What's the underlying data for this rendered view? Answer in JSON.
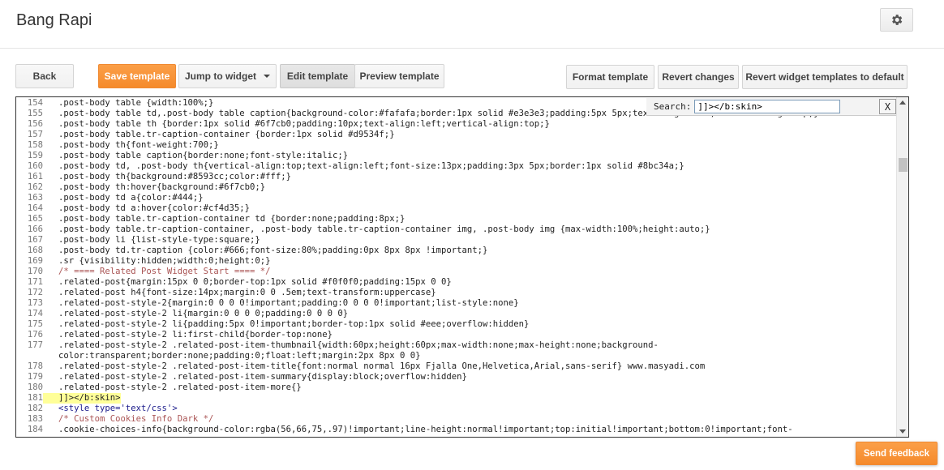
{
  "header": {
    "title": "Bang Rapi",
    "settings_icon": "gear-icon"
  },
  "toolbar": {
    "back": "Back",
    "save": "Save template",
    "jump": "Jump to widget",
    "edit": "Edit template",
    "preview": "Preview template",
    "format": "Format template",
    "revert": "Revert changes",
    "revert_widgets": "Revert widget templates to default"
  },
  "search": {
    "label": "Search:",
    "value": "]]></b:skin>",
    "close": "X"
  },
  "feedback": "Send feedback",
  "colors": {
    "accent": "#f58a2b",
    "highlight": "#ffff99"
  },
  "editor": {
    "lines": [
      {
        "n": "154",
        "text": ".post-body table {width:100%;}"
      },
      {
        "n": "155",
        "text": ".post-body table td,.post-body table caption{background-color:#fafafa;border:1px solid #e3e3e3;padding:5px 5px;text-align:left;vertical-align:top;}"
      },
      {
        "n": "156",
        "text": ".post-body table th {border:1px solid #6f7cb0;padding:10px;text-align:left;vertical-align:top;}"
      },
      {
        "n": "157",
        "text": ".post-body table.tr-caption-container {border:1px solid #d9534f;}"
      },
      {
        "n": "158",
        "text": ".post-body th{font-weight:700;}"
      },
      {
        "n": "159",
        "text": ".post-body table caption{border:none;font-style:italic;}"
      },
      {
        "n": "160",
        "text": ".post-body td, .post-body th{vertical-align:top;text-align:left;font-size:13px;padding:3px 5px;border:1px solid #8bc34a;}"
      },
      {
        "n": "161",
        "text": ".post-body th{background:#8593cc;color:#fff;}"
      },
      {
        "n": "162",
        "text": ".post-body th:hover{background:#6f7cb0;}"
      },
      {
        "n": "163",
        "text": ".post-body td a{color:#444;}"
      },
      {
        "n": "164",
        "text": ".post-body td a:hover{color:#cf4d35;}"
      },
      {
        "n": "165",
        "text": ".post-body table.tr-caption-container td {border:none;padding:8px;}"
      },
      {
        "n": "166",
        "text": ".post-body table.tr-caption-container, .post-body table.tr-caption-container img, .post-body img {max-width:100%;height:auto;}"
      },
      {
        "n": "167",
        "text": ".post-body li {list-style-type:square;}"
      },
      {
        "n": "168",
        "text": ".post-body td.tr-caption {color:#666;font-size:80%;padding:0px 8px 8px !important;}"
      },
      {
        "n": "169",
        "text": ".sr {visibility:hidden;width:0;height:0;}"
      },
      {
        "n": "170",
        "text": "/* ==== Related Post Widget Start ==== */"
      },
      {
        "n": "171",
        "text": ".related-post{margin:15px 0 0;border-top:1px solid #f0f0f0;padding:15px 0 0}"
      },
      {
        "n": "172",
        "text": ".related-post h4{font-size:14px;margin:0 0 .5em;text-transform:uppercase}"
      },
      {
        "n": "173",
        "text": ".related-post-style-2{margin:0 0 0 0!important;padding:0 0 0 0!important;list-style:none}"
      },
      {
        "n": "174",
        "text": ".related-post-style-2 li{margin:0 0 0 0;padding:0 0 0 0}"
      },
      {
        "n": "175",
        "text": ".related-post-style-2 li{padding:5px 0!important;border-top:1px solid #eee;overflow:hidden}"
      },
      {
        "n": "176",
        "text": ".related-post-style-2 li:first-child{border-top:none}"
      },
      {
        "n": "177",
        "text": ".related-post-style-2 .related-post-item-thumbnail{width:60px;height:60px;max-width:none;max-height:none;background-"
      },
      {
        "n": "",
        "text": "color:transparent;border:none;padding:0;float:left;margin:2px 8px 0 0}"
      },
      {
        "n": "178",
        "text": ".related-post-style-2 .related-post-item-title{font:normal normal 16px Fjalla One,Helvetica,Arial,sans-serif} www.masyadi.com"
      },
      {
        "n": "179",
        "text": ".related-post-style-2 .related-post-item-summary{display:block;overflow:hidden}"
      },
      {
        "n": "180",
        "text": ".related-post-style-2 .related-post-item-more{}"
      },
      {
        "n": "181",
        "text": "]]></b:skin>"
      },
      {
        "n": "182",
        "text": "<style type='text/css'>"
      },
      {
        "n": "183",
        "text": "/* Custom Cookies Info Dark */"
      },
      {
        "n": "184",
        "text": ".cookie-choices-info{background-color:rgba(56,66,75,.97)!important;line-height:normal!important;top:initial!important;bottom:0!important;font-"
      }
    ]
  }
}
